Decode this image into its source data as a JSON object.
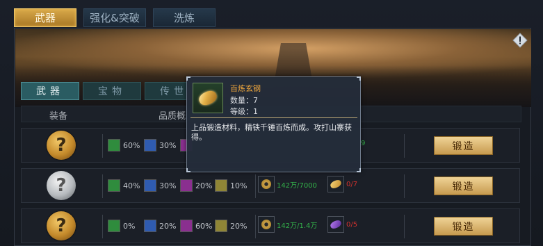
{
  "top_tabs": [
    {
      "label": "武器",
      "active": true
    },
    {
      "label": "强化&突破",
      "active": false
    },
    {
      "label": "洗炼",
      "active": false
    }
  ],
  "sub_tabs": [
    {
      "label": "武器",
      "active": true
    },
    {
      "label": "宝物",
      "active": false
    },
    {
      "label": "传世",
      "active": false
    }
  ],
  "header": {
    "equip_label": "装备",
    "quality_label": "品质概"
  },
  "rows": [
    {
      "slot_color": "gold",
      "slot_mark": "?",
      "qualities": [
        "60%",
        "30%"
      ],
      "material_1": {
        "amount": "",
        "color": "green"
      },
      "material_2": {
        "amount": "9",
        "color": "green"
      },
      "forge_label": "锻造"
    },
    {
      "slot_color": "silver",
      "slot_mark": "?",
      "qualities": [
        "40%",
        "30%",
        "20%",
        "10%"
      ],
      "material_1": {
        "amount": "142万/7000",
        "color": "green"
      },
      "material_2": {
        "amount": "0/7",
        "color": "red"
      },
      "forge_label": "锻造"
    },
    {
      "slot_color": "gold",
      "slot_mark": "?",
      "qualities": [
        "0%",
        "20%",
        "60%",
        "20%"
      ],
      "material_1": {
        "amount": "142万/1.4万",
        "color": "green"
      },
      "material_2": {
        "amount": "0/5",
        "color": "red"
      },
      "forge_label": "锻造"
    }
  ],
  "tooltip": {
    "name": "百炼玄钢",
    "quantity": "数量：7",
    "level": "等级：1",
    "description": "上品锻造材料，精铁千锤百炼而成。攻打山寨获得。",
    "name_color": "#f3a93d"
  },
  "icons": {
    "info": "info-diamond-icon",
    "coin": "coin-icon",
    "ore": "ore-icon"
  }
}
